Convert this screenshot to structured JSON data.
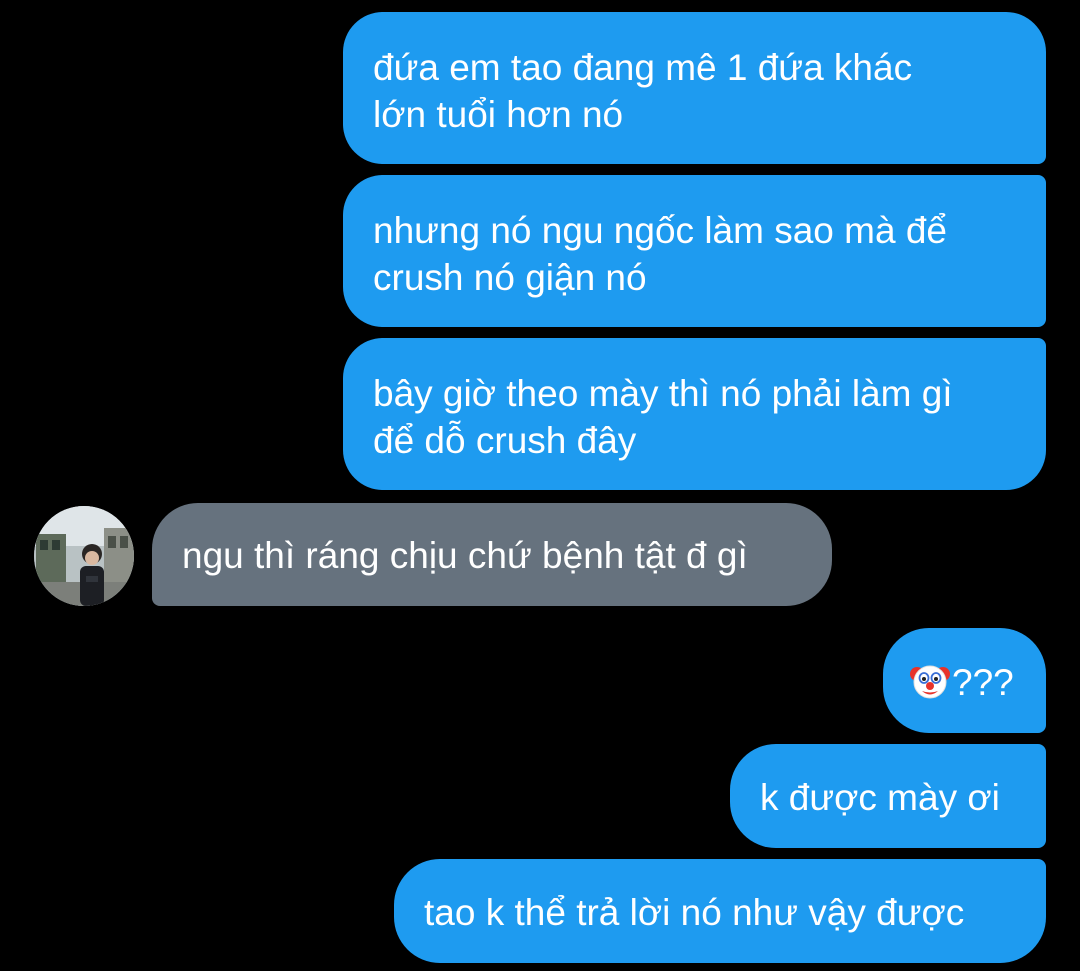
{
  "messages": [
    {
      "from": "me",
      "lines": [
        "đứa em tao đang mê 1 đứa khác",
        "lớn tuổi hơn nó"
      ]
    },
    {
      "from": "me",
      "lines": [
        "nhưng nó ngu ngốc làm sao mà để",
        "crush nó giận nó"
      ]
    },
    {
      "from": "me",
      "lines": [
        "bây giờ theo mày thì nó phải làm gì",
        "để dỗ crush đây"
      ]
    },
    {
      "from": "other",
      "text": "ngu thì ráng chịu chứ bệnh tật đ gì"
    },
    {
      "from": "me",
      "icon": "clown-face-icon",
      "text": "???"
    },
    {
      "from": "me",
      "text": "k được mày ơi"
    },
    {
      "from": "me",
      "text": "tao k thể trả lời nó như vậy được"
    }
  ],
  "colors": {
    "background": "#000000",
    "sent_bubble": "#1e9bf0",
    "received_bubble": "#66727e",
    "text": "#ffffff"
  }
}
